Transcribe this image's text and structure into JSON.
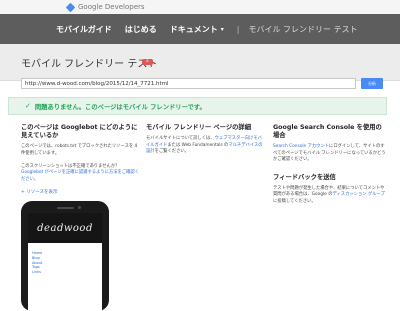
{
  "brand": {
    "logo_text": "Google Developers"
  },
  "nav": {
    "items": [
      {
        "label": "モバイルガイド"
      },
      {
        "label": "はじめる"
      },
      {
        "label": "ドキュメント"
      }
    ],
    "current": "モバイル フレンドリー テスト"
  },
  "header": {
    "title": "モバイル フレンドリー テスト",
    "badge": "β"
  },
  "url_form": {
    "value": "http://www.d-wood.com/blog/2015/12/14_7721.html",
    "button_label": "分析"
  },
  "result": {
    "text": "問題ありません。このページはモバイル フレンドリーです。",
    "color": "#23a457"
  },
  "googlebot": {
    "title": "このページは Googlebot にどのように見えているか",
    "body_1": "このページでは、robots.txt でブロックされたリソースを 4 件使用しています。",
    "body_2": "このスクリーンショットは不正確でありませんか？",
    "link_1": "Googlebot がページを正確に認識するように方法をご確認ください。",
    "resources_link": "+ リソースを表示"
  },
  "mobile_design": {
    "title": "モバイル フレンドリー ページの詳細",
    "body_1": "モバイルサイトについて詳しくは、",
    "link_1": "ウェブマスター向けモバイルガイド",
    "body_2": "または Web Fundamentals の",
    "link_2": "マルチデバイスの設計",
    "body_3": "をご覧ください。"
  },
  "search_console": {
    "title": "Google Search Console を使用の場合",
    "link_1": "Search Console アカウント",
    "body_1": "にログインして、サイトのすべてのページでモバイル フレンドリーになっているかどうかご確認ください。"
  },
  "feedback": {
    "title": "フィードバックを送信",
    "body_1": "テストや問題が発生した場合や、結果についてコメントや質問がある場合は、Google の",
    "link_1": "ディスカッション グループ",
    "body_2": "に投稿してください。"
  },
  "preview": {
    "site_title": "deadwood",
    "menu_items": [
      "Home",
      "Blog",
      "About",
      "Tags",
      "Links"
    ]
  }
}
